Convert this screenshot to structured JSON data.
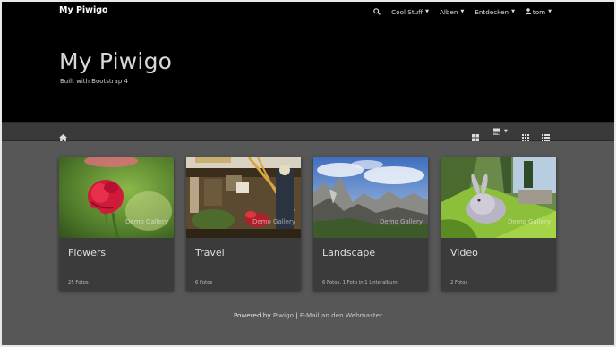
{
  "navbar": {
    "brand": "My Piwigo",
    "search_icon": "search-icon",
    "menu": [
      {
        "label": "Cool Stuff"
      },
      {
        "label": "Alben"
      },
      {
        "label": "Entdecken"
      }
    ],
    "user": {
      "label": "tom",
      "icon": "user-icon"
    }
  },
  "jumbotron": {
    "title": "My Piwigo",
    "subtitle": "Built with Bootstrap 4"
  },
  "toolbar": {
    "home_icon": "home-icon",
    "tools": [
      "grid-view-icon",
      "calendar-icon",
      "thumbnails-icon",
      "list-view-icon"
    ]
  },
  "albums": [
    {
      "title": "Flowers",
      "count": "25 Fotos",
      "watermark": "Demo Gallery"
    },
    {
      "title": "Travel",
      "count": "6 Fotos",
      "watermark": "Demo Gallery"
    },
    {
      "title": "Landscape",
      "count": "6 Fotos, 1 Foto in 1 Unteralbum",
      "watermark": "Demo Gallery"
    },
    {
      "title": "Video",
      "count": "2 Fotos",
      "watermark": "Demo Gallery"
    }
  ],
  "footer": {
    "prefix": "Powered by ",
    "piwigo_link": "Piwigo",
    "separator": " | ",
    "email_link": "E-Mail an den Webmaster"
  },
  "colors": {
    "navbar_bg": "#000000",
    "page_bg": "#575757",
    "card_bg": "#3b3b3b"
  }
}
